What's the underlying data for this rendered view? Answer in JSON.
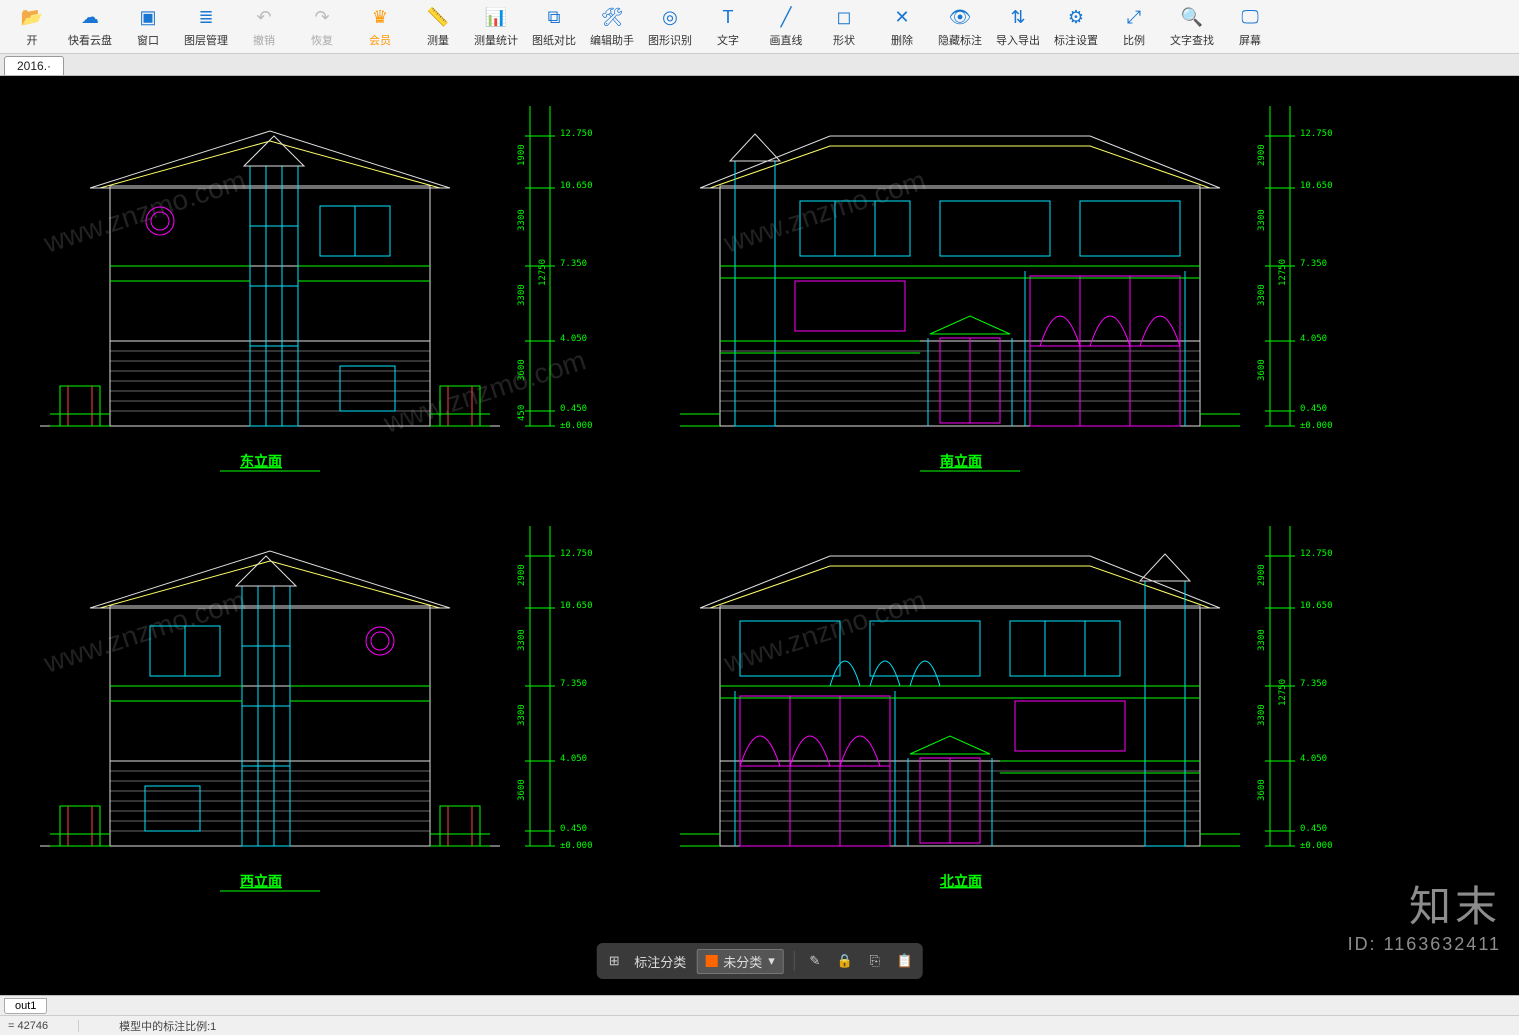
{
  "toolbar": {
    "items": [
      {
        "id": "open",
        "label": "开",
        "icon": "folder"
      },
      {
        "id": "cloud",
        "label": "快看云盘",
        "icon": "cloud"
      },
      {
        "id": "window",
        "label": "窗口",
        "icon": "windows"
      },
      {
        "id": "layers",
        "label": "图层管理",
        "icon": "layers"
      },
      {
        "id": "undo",
        "label": "撤销",
        "icon": "undo",
        "disabled": true
      },
      {
        "id": "redo",
        "label": "恢复",
        "icon": "redo",
        "disabled": true
      },
      {
        "id": "vip",
        "label": "会员",
        "icon": "vip",
        "vip": true
      },
      {
        "id": "measure",
        "label": "测量",
        "icon": "ruler"
      },
      {
        "id": "measure-stats",
        "label": "测量统计",
        "icon": "stats"
      },
      {
        "id": "compare",
        "label": "图纸对比",
        "icon": "compare"
      },
      {
        "id": "edit-assist",
        "label": "编辑助手",
        "icon": "assist"
      },
      {
        "id": "shape-rec",
        "label": "图形识别",
        "icon": "recognize"
      },
      {
        "id": "text",
        "label": "文字",
        "icon": "text"
      },
      {
        "id": "line",
        "label": "画直线",
        "icon": "line"
      },
      {
        "id": "shape",
        "label": "形状",
        "icon": "shape"
      },
      {
        "id": "delete",
        "label": "删除",
        "icon": "delete"
      },
      {
        "id": "hide-anno",
        "label": "隐藏标注",
        "icon": "hide"
      },
      {
        "id": "import-export",
        "label": "导入导出",
        "icon": "io"
      },
      {
        "id": "anno-settings",
        "label": "标注设置",
        "icon": "settings"
      },
      {
        "id": "scale",
        "label": "比例",
        "icon": "scale"
      },
      {
        "id": "text-search",
        "label": "文字查找",
        "icon": "search"
      },
      {
        "id": "screen",
        "label": "屏幕",
        "icon": "screen"
      }
    ]
  },
  "file_tab": "2016.·",
  "elevations": {
    "top_left": {
      "title": "东立面"
    },
    "top_right": {
      "title": "南立面"
    },
    "bot_left": {
      "title": "西立面"
    },
    "bot_right": {
      "title": "北立面"
    }
  },
  "dimensions": {
    "levels": [
      "±0.000",
      "0.450",
      "4.050",
      "7.350",
      "10.650",
      "12.750"
    ],
    "vertical": [
      "450",
      "3600",
      "3300",
      "3300",
      "1900",
      "12750"
    ],
    "top_height": "2900"
  },
  "anno_bar": {
    "category_label": "标注分类",
    "tag_label": "未分类",
    "tag_color": "#ff6600"
  },
  "bottom_tab": "out1",
  "status": {
    "left": "= 42746",
    "center": "模型中的标注比例:1"
  },
  "watermark_text": "www.znzmo.com",
  "brand": {
    "name": "知末",
    "id": "ID: 1163632411"
  }
}
